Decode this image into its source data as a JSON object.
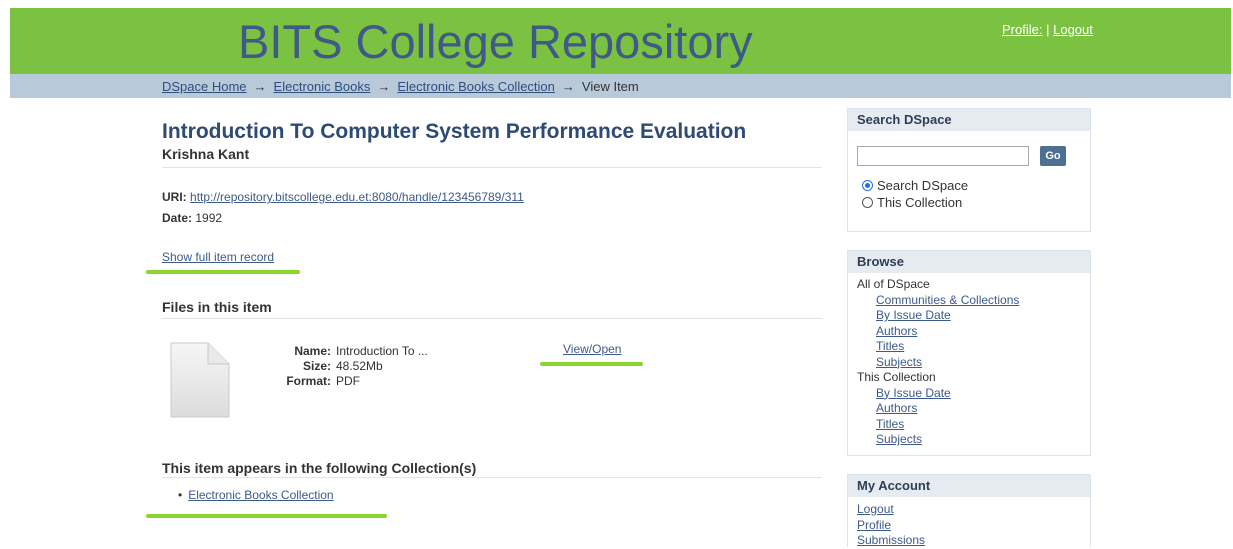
{
  "header": {
    "site_title": "BITS College Repository",
    "profile_link": "Profile:",
    "separator": "|",
    "logout_link": "Logout"
  },
  "breadcrumb": {
    "items": [
      "DSpace Home",
      "Electronic Books",
      "Electronic Books Collection"
    ],
    "current": "View Item",
    "arrow": "→"
  },
  "item": {
    "title": "Introduction To Computer System Performance Evaluation",
    "author": "Krishna Kant",
    "uri_label": "URI:",
    "uri_value": "http://repository.bitscollege.edu.et:8080/handle/123456789/311",
    "date_label": "Date:",
    "date_value": "1992",
    "show_full_link": "Show full item record"
  },
  "files": {
    "heading": "Files in this item",
    "name_label": "Name:",
    "name_value": "Introduction To ...",
    "size_label": "Size:",
    "size_value": "48.52Mb",
    "format_label": "Format:",
    "format_value": "PDF",
    "view_open": "View/Open",
    "icon": "document-icon"
  },
  "collections": {
    "heading": "This item appears in the following Collection(s)",
    "bullet": "•",
    "items": [
      "Electronic Books Collection"
    ]
  },
  "sidebar": {
    "search": {
      "heading": "Search DSpace",
      "input_value": "",
      "go_button": "Go",
      "scope_options": [
        "Search DSpace",
        "This Collection"
      ],
      "selected_scope": "Search DSpace"
    },
    "browse": {
      "heading": "Browse",
      "all_label": "All of DSpace",
      "all_links": [
        "Communities & Collections",
        "By Issue Date",
        "Authors",
        "Titles",
        "Subjects"
      ],
      "collection_label": "This Collection",
      "collection_links": [
        "By Issue Date",
        "Authors",
        "Titles",
        "Subjects"
      ]
    },
    "account": {
      "heading": "My Account",
      "links": [
        "Logout",
        "Profile",
        "Submissions"
      ]
    }
  },
  "colors": {
    "header_green": "#7cc242",
    "title_blue": "#3f5a88",
    "breadcrumb_bar": "#b8c9d9",
    "highlight_green": "#8bd52e",
    "go_button": "#4d6f91"
  }
}
